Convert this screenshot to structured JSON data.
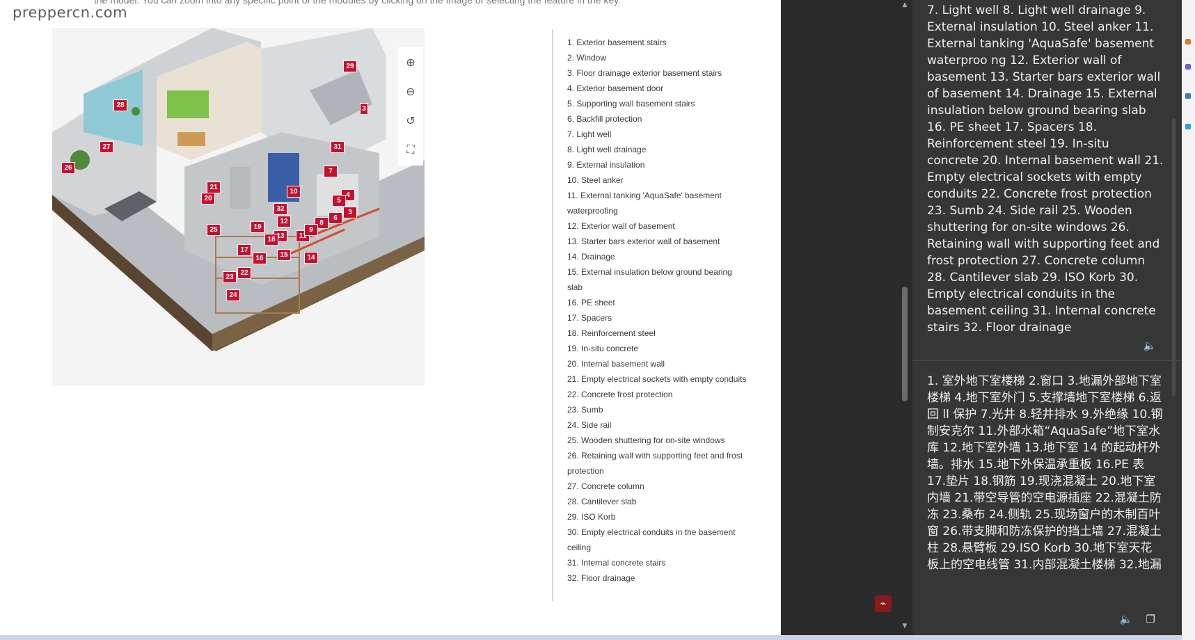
{
  "watermark": "preppercn.com",
  "intro_text_cut": "the model. You can zoom into any specific point of the modules by clicking on the image or selecting the feature in the key.",
  "zoom_controls": [
    {
      "name": "zoom-in-icon",
      "glyph": "⊕"
    },
    {
      "name": "zoom-out-icon",
      "glyph": "⊖"
    },
    {
      "name": "reset-icon",
      "glyph": "↺"
    },
    {
      "name": "fullscreen-icon",
      "glyph": "⛶"
    }
  ],
  "markers": [
    "28",
    "27",
    "26",
    "29",
    "3",
    "31",
    "7",
    "21",
    "20",
    "10",
    "4",
    "5",
    "3",
    "32",
    "12",
    "6",
    "8",
    "25",
    "19",
    "13",
    "11",
    "9",
    "18",
    "17",
    "16",
    "15",
    "14",
    "23",
    "22",
    "24"
  ],
  "key_list": [
    "1. Exterior basement stairs",
    "2. Window",
    "3. Floor drainage exterior basement stairs",
    "4. Exterior basement door",
    "5. Supporting wall basement stairs",
    "6. Backfill protection",
    "7. Light well",
    "8. Light well drainage",
    "9. External insulation",
    "10. Steel anker",
    "11. External tanking 'AquaSafe' basement waterproofing",
    "12. Exterior wall of basement",
    "13. Starter bars exterior wall of basement",
    "14. Drainage",
    "15. External insulation below ground bearing slab",
    "16. PE sheet",
    "17. Spacers",
    "18. Reinforcement steel",
    "19. In-situ concrete",
    "20. Internal basement wall",
    "21. Empty electrical sockets with empty conduits",
    "22. Concrete frost protection",
    "23. Sumb",
    "24. Side rail",
    "25. Wooden shuttering for on-site windows",
    "26. Retaining wall with supporting feet and frost protection",
    "27. Concrete column",
    "28. Cantilever slab",
    "29. ISO Korb",
    "30. Empty electrical conduits in the basement ceiling",
    "31. Internal concrete stairs",
    "32. Floor drainage"
  ],
  "panel": {
    "english": "7. Light well 8. Light well drainage 9. External insulation 10. Steel anker 11. External tanking 'AquaSafe' basement waterproo ng 12. Exterior wall of basement 13. Starter bars exterior wall of basement 14. Drainage 15. External insulation below ground bearing slab 16. PE sheet 17. Spacers 18. Reinforcement steel 19. In-situ concrete 20. Internal basement wall 21. Empty electrical sockets with empty conduits 22. Concrete frost protection 23. Sumb 24. Side rail 25. Wooden shuttering for on-site windows 26. Retaining wall with supporting feet and frost protection 27. Concrete column 28. Cantilever slab 29. ISO Korb 30. Empty electrical conduits in the basement ceiling 31. Internal concrete stairs 32. Floor drainage",
    "chinese": "1. 室外地下室楼梯 2.窗口 3.地漏外部地下室楼梯 4.地下室外门 5.支撑墙地下室楼梯 6.返回 ll 保护 7.光井 8.轻井排水 9.外绝缘 10.钢制安克尔 11.外部水箱“AquaSafe”地下室水库 12.地下室外墙 13.地下室 14 的起动杆外墙。排水 15.地下外保温承重板 16.PE 表 17.垫片 18.钢筋 19.现浇混凝土 20.地下室内墙 21.带空导管的空电源插座 22.混凝土防冻 23.桑布 24.侧轨 25.现场窗户的木制百叶窗 26.带支脚和防冻保护的挡土墙 27.混凝土柱 28.悬臂板 29.ISO Korb 30.地下室天花板上的空电线管 31.内部混凝土楼梯 32.地漏"
  },
  "colors": {
    "marker": "#c8102e",
    "panel_bg": "#363636",
    "dark_bg": "#2b2b2b"
  }
}
